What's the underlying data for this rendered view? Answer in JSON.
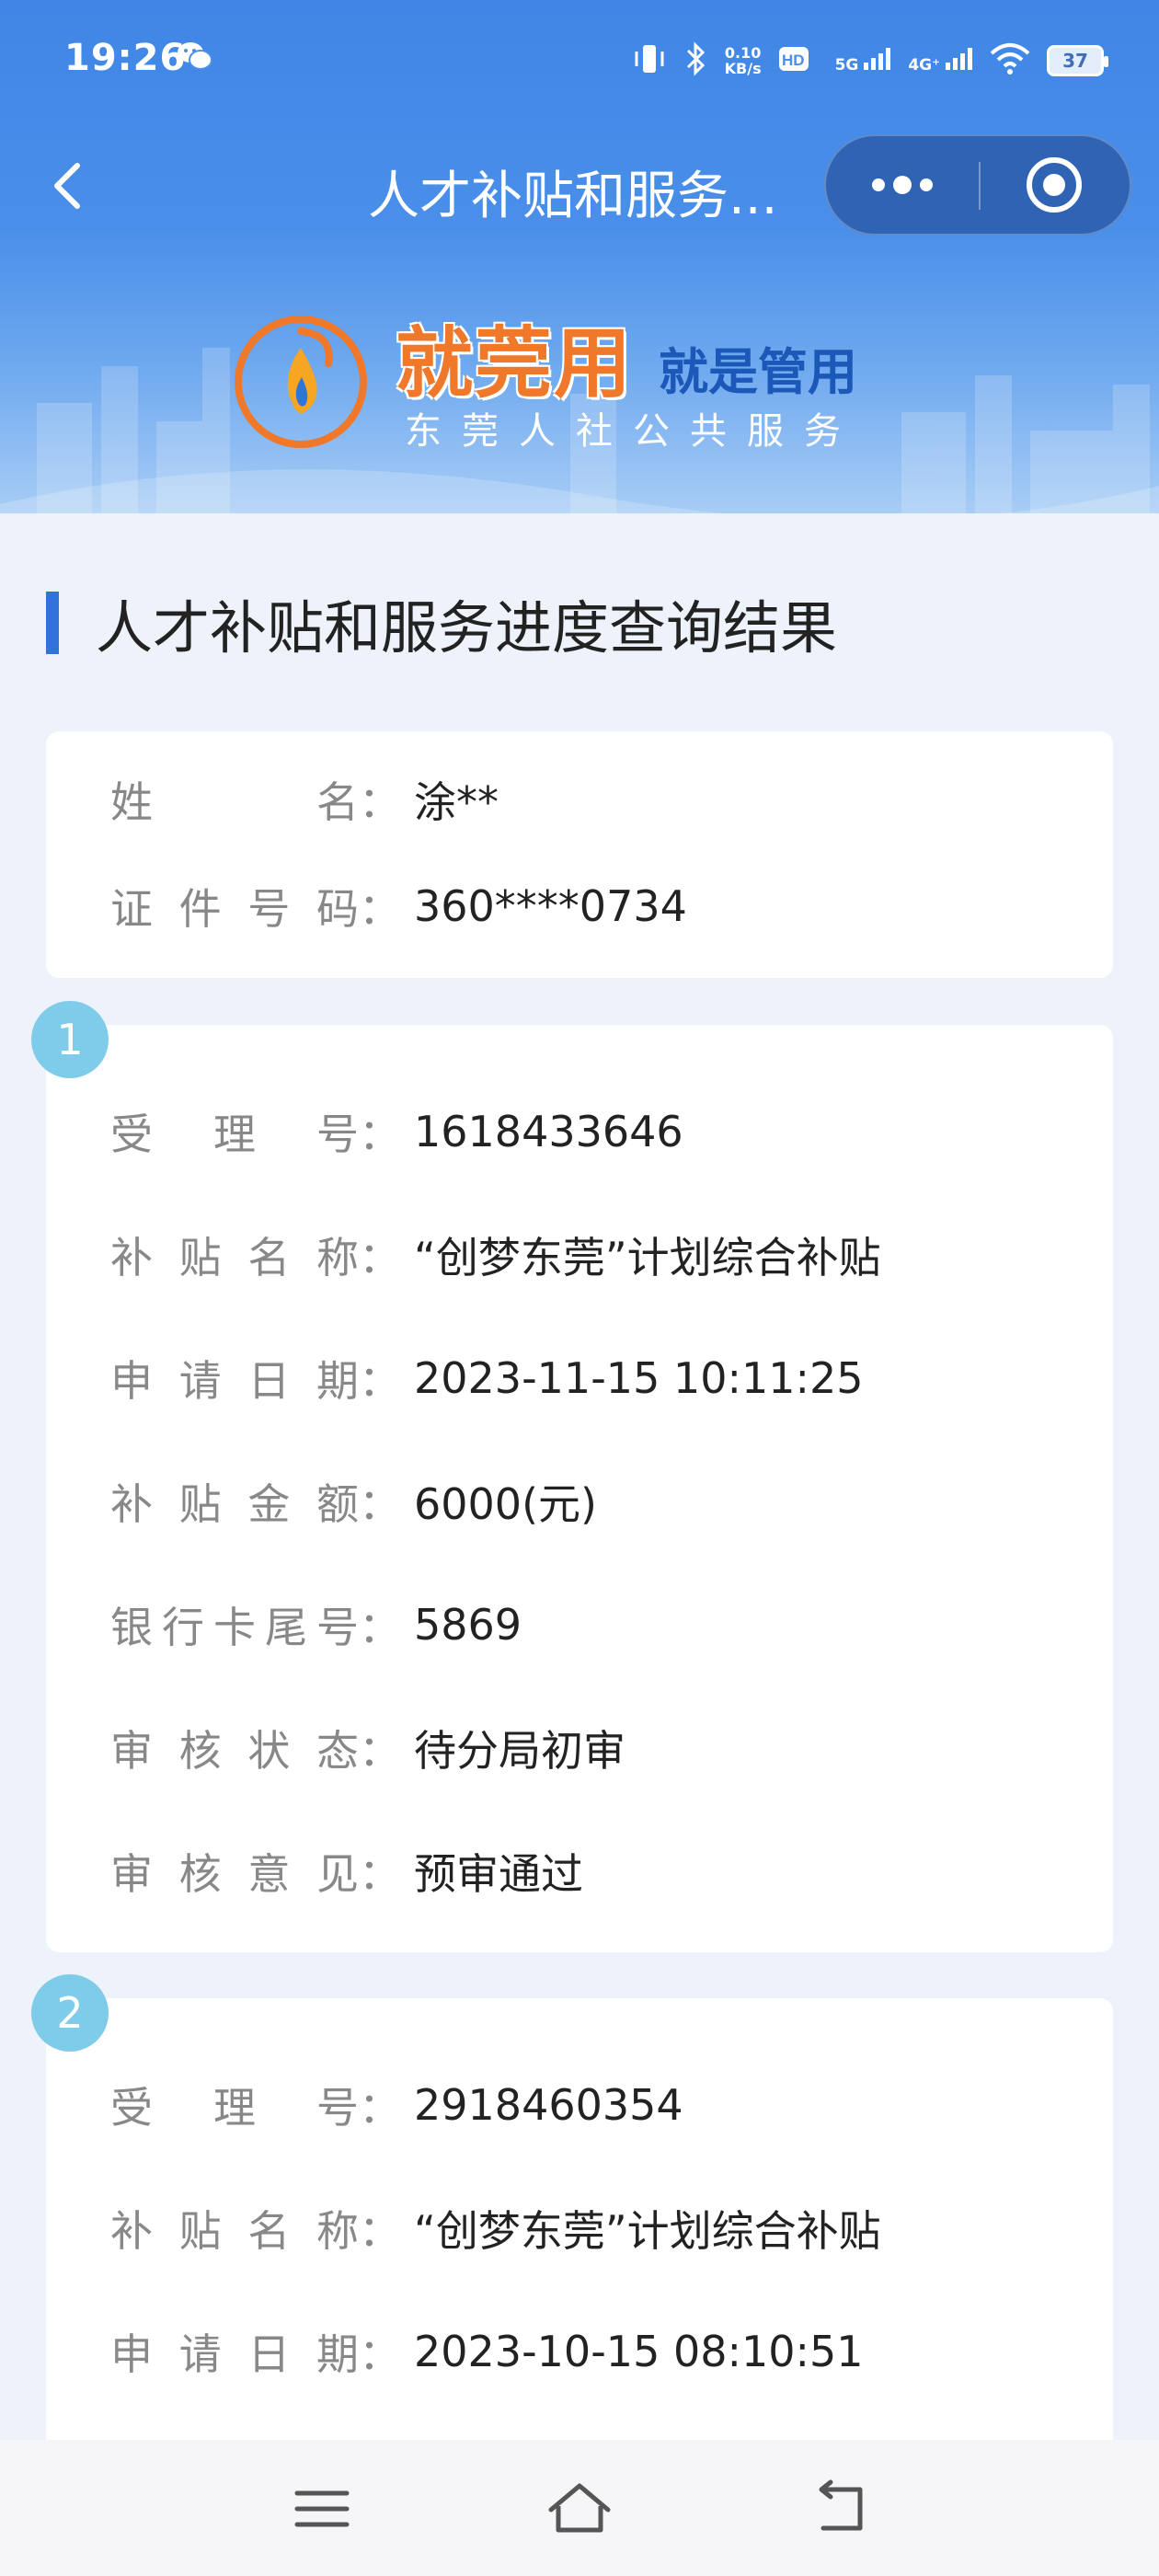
{
  "status_bar": {
    "time": "19:26",
    "speed_value": "0.10",
    "speed_unit": "KB/s",
    "net1": "5G",
    "net2": "4G⁺",
    "battery": "37"
  },
  "title_bar": {
    "title": "人才补贴和服务..."
  },
  "banner": {
    "logo_text": "就莞用",
    "slogan": "就是管用",
    "subtitle": "东莞人社公共服务"
  },
  "page_title": "人才补贴和服务进度查询结果",
  "person": {
    "name_label": [
      "姓",
      "名"
    ],
    "name_value": "涂**",
    "id_label": [
      "证",
      "件",
      "号",
      "码"
    ],
    "id_value": "360****0734"
  },
  "records": [
    {
      "index": "1",
      "fields": [
        {
          "label": [
            "受",
            "理",
            "号"
          ],
          "value": "1618433646"
        },
        {
          "label": [
            "补",
            "贴",
            "名",
            "称"
          ],
          "value": "“创梦东莞”计划综合补贴"
        },
        {
          "label": [
            "申",
            "请",
            "日",
            "期"
          ],
          "value": "2023-11-15 10:11:25"
        },
        {
          "label": [
            "补",
            "贴",
            "金",
            "额"
          ],
          "value": "6000(元)"
        },
        {
          "label": [
            "银",
            "行",
            "卡",
            "尾",
            "号"
          ],
          "value": "5869"
        },
        {
          "label": [
            "审",
            "核",
            "状",
            "态"
          ],
          "value": "待分局初审"
        },
        {
          "label": [
            "审",
            "核",
            "意",
            "见"
          ],
          "value": "预审通过"
        }
      ]
    },
    {
      "index": "2",
      "fields": [
        {
          "label": [
            "受",
            "理",
            "号"
          ],
          "value": "2918460354"
        },
        {
          "label": [
            "补",
            "贴",
            "名",
            "称"
          ],
          "value": "“创梦东莞”计划综合补贴"
        },
        {
          "label": [
            "申",
            "请",
            "日",
            "期"
          ],
          "value": "2023-10-15 08:10:51"
        }
      ]
    }
  ],
  "colon": "：",
  "icons": {
    "back": "chevron-left-icon",
    "more": "more-dots-icon",
    "close": "target-close-icon",
    "menu": "menu-icon",
    "home": "home-icon",
    "return": "back-arrow-icon"
  },
  "colors": {
    "header_blue": "#3f86e6",
    "accent": "#2f74d9",
    "badge": "#7fcbea",
    "logo_orange": "#f0782a"
  }
}
